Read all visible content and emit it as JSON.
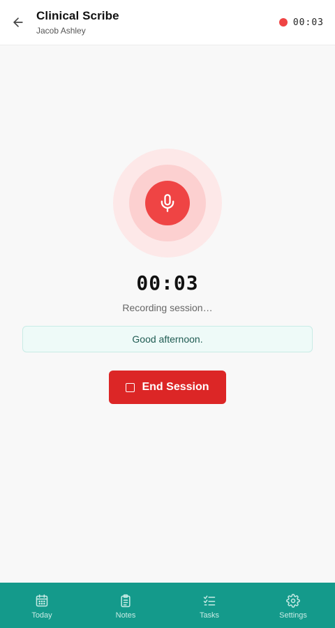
{
  "header": {
    "title": "Clinical Scribe",
    "patient_name": "Jacob Ashley",
    "recording_timer": "00:03"
  },
  "recorder": {
    "timer": "00:03",
    "status": "Recording session…",
    "transcript": "Good afternoon.",
    "end_button_label": "End Session"
  },
  "bottom_nav": {
    "items": [
      {
        "label": "Today",
        "icon": "calendar-icon"
      },
      {
        "label": "Notes",
        "icon": "clipboard-icon"
      },
      {
        "label": "Tasks",
        "icon": "checklist-icon"
      },
      {
        "label": "Settings",
        "icon": "gear-icon"
      }
    ]
  },
  "colors": {
    "accent": "#149a8b",
    "recording": "#ef4444",
    "end_button": "#dc2626"
  }
}
